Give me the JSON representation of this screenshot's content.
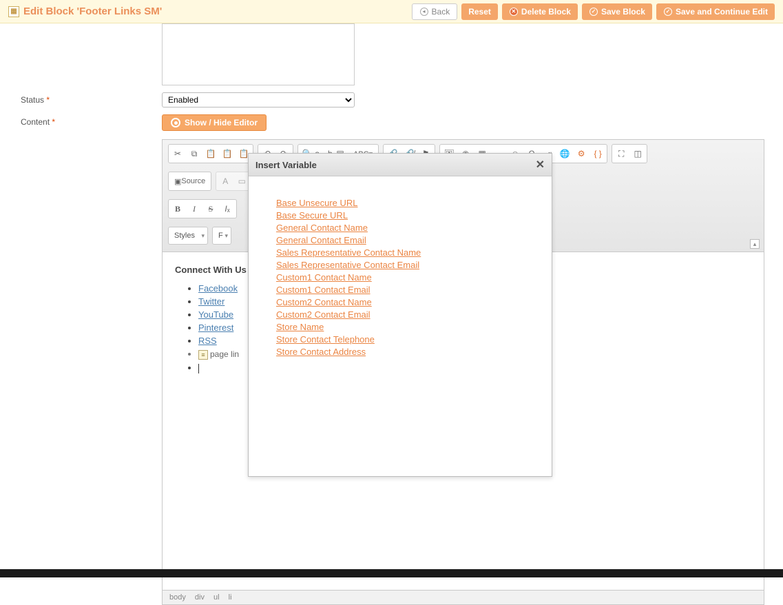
{
  "header": {
    "title": "Edit Block 'Footer Links SM'",
    "buttons": {
      "back": "Back",
      "reset": "Reset",
      "delete": "Delete Block",
      "save": "Save Block",
      "save_continue": "Save and Continue Edit"
    }
  },
  "form": {
    "status_label": "Status",
    "status_value": "Enabled",
    "content_label": "Content",
    "show_hide": "Show / Hide Editor"
  },
  "toolbar": {
    "source": "Source",
    "styles": "Styles",
    "format_short": "F"
  },
  "content": {
    "heading": "Connect With Us",
    "links": [
      "Facebook",
      "Twitter",
      "YouTube",
      "Pinterest",
      "RSS"
    ],
    "widget_label": "page lin"
  },
  "statusbar": {
    "path": [
      "body",
      "div",
      "ul",
      "li"
    ]
  },
  "modal": {
    "title": "Insert Variable",
    "items": [
      "Base Unsecure URL",
      "Base Secure URL",
      "General Contact Name",
      "General Contact Email",
      "Sales Representative Contact Name",
      "Sales Representative Contact Email",
      "Custom1 Contact Name",
      "Custom1 Contact Email",
      "Custom2 Contact Name",
      "Custom2 Contact Email",
      "Store Name",
      "Store Contact Telephone",
      "Store Contact Address"
    ]
  }
}
